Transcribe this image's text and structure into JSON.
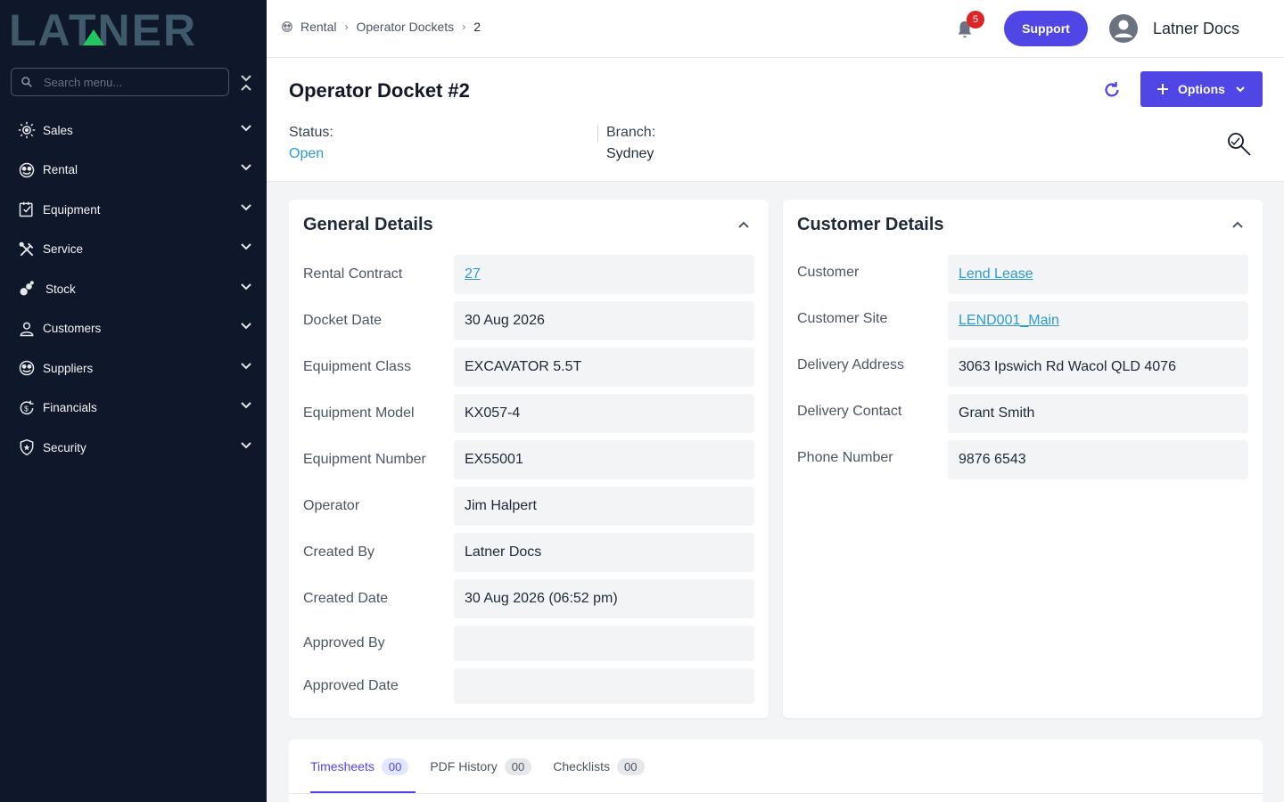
{
  "sidebar": {
    "logo_text": "LATNER",
    "search_placeholder": "Search menu...",
    "items": [
      {
        "label": "Sales",
        "icon": "sales-icon"
      },
      {
        "label": "Rental",
        "icon": "rental-icon"
      },
      {
        "label": "Equipment",
        "icon": "equipment-icon"
      },
      {
        "label": "Service",
        "icon": "service-icon"
      },
      {
        "label": "Stock",
        "icon": "stock-icon"
      },
      {
        "label": "Customers",
        "icon": "customers-icon"
      },
      {
        "label": "Suppliers",
        "icon": "suppliers-icon"
      },
      {
        "label": "Financials",
        "icon": "financials-icon"
      },
      {
        "label": "Security",
        "icon": "security-icon"
      }
    ]
  },
  "topbar": {
    "breadcrumb": [
      "Rental",
      "Operator Dockets",
      "2"
    ],
    "notification_count": "5",
    "support_label": "Support",
    "user_name": "Latner Docs"
  },
  "header": {
    "title": "Operator Docket",
    "number": "#2",
    "options_label": "Options",
    "status_label": "Status:",
    "status_value": "Open",
    "branch_label": "Branch:",
    "branch_value": "Sydney"
  },
  "general": {
    "title": "General Details",
    "rows": [
      {
        "label": "Rental Contract",
        "value": "27"
      },
      {
        "label": "Docket Date",
        "value": "30 Aug 2026"
      },
      {
        "label": "Equipment Class",
        "value": "EXCAVATOR 5.5T"
      },
      {
        "label": "Equipment Model",
        "value": "KX057-4"
      },
      {
        "label": "Equipment Number",
        "value": "EX55001"
      },
      {
        "label": "Operator",
        "value": "Jim Halpert"
      },
      {
        "label": "Created By",
        "value": "Latner Docs"
      },
      {
        "label": "Created Date",
        "value": "30 Aug 2026 (06:52 pm)"
      },
      {
        "label": "Approved By",
        "value": ""
      },
      {
        "label": "Approved Date",
        "value": ""
      }
    ]
  },
  "customer": {
    "title": "Customer Details",
    "rows": [
      {
        "label": "Customer",
        "value": "Lend Lease"
      },
      {
        "label": "Customer Site",
        "value": "LEND001_Main"
      },
      {
        "label": "Delivery Address",
        "value": "3063 Ipswich Rd Wacol QLD 4076"
      },
      {
        "label": "Delivery Contact",
        "value": "Grant Smith"
      },
      {
        "label": "Phone Number",
        "value": "9876 6543"
      }
    ]
  },
  "tabs": [
    {
      "label": "Timesheets",
      "count": "00"
    },
    {
      "label": "PDF History",
      "count": "00"
    },
    {
      "label": "Checklists",
      "count": "00"
    }
  ],
  "colors": {
    "sidebar_bg": "#0f172a",
    "accent": "#4f46e5",
    "link": "#2e9ad0",
    "badge": "#dc2626"
  }
}
